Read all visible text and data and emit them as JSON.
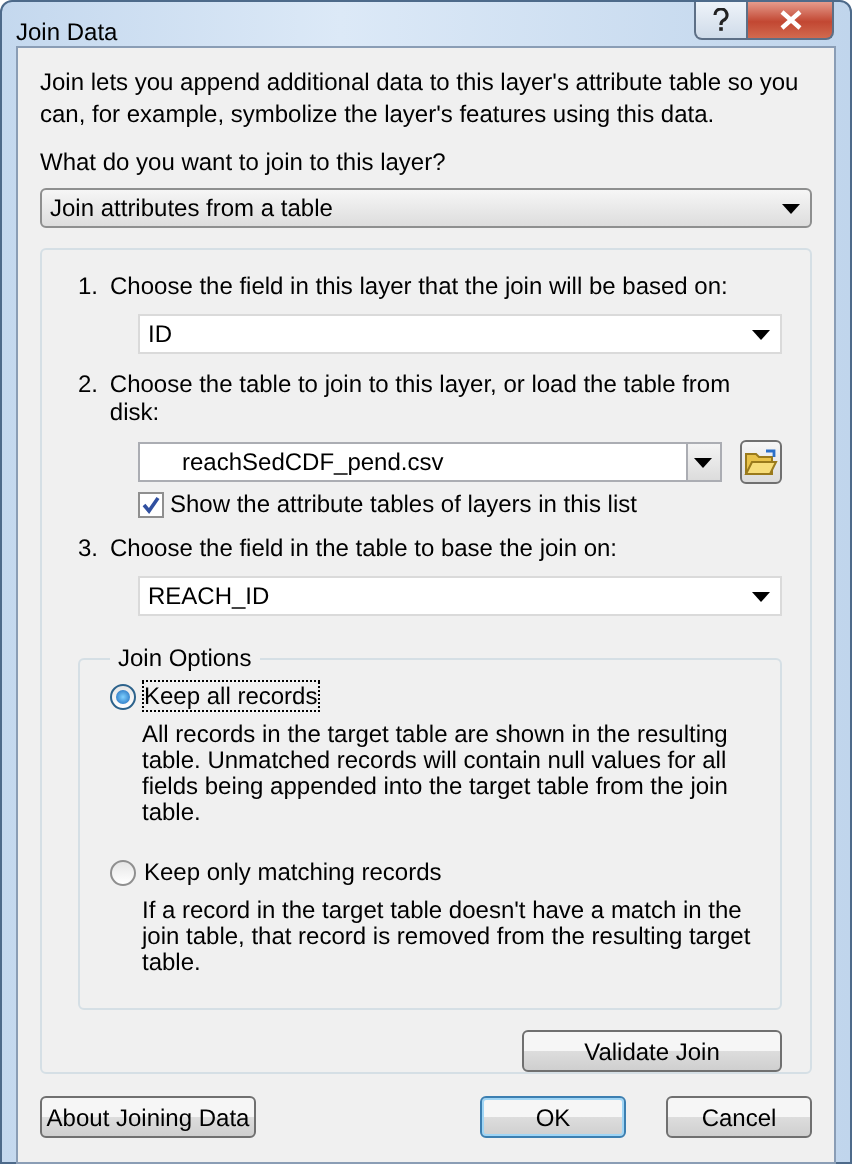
{
  "window": {
    "title": "Join Data"
  },
  "intro": "Join lets you append additional data to this layer's attribute table so you can, for example, symbolize the layer's features using this data.",
  "join_type": {
    "label": "What do you want to join to this layer?",
    "value": "Join attributes from a table"
  },
  "steps": [
    {
      "number": "1.",
      "label": "Choose the field in this layer that the join will be based on:",
      "value": "ID",
      "kind": "dropdown"
    },
    {
      "number": "2.",
      "label": "Choose the table to join to this layer, or load the table from disk:",
      "value": "reachSedCDF_pend.csv",
      "kind": "browse",
      "checkbox": {
        "label": "Show the attribute tables of layers in this list",
        "checked": true
      }
    },
    {
      "number": "3.",
      "label": "Choose the field in the table to base the join on:",
      "value": "REACH_ID",
      "kind": "dropdown"
    }
  ],
  "join_options": {
    "title": "Join Options",
    "options": [
      {
        "label": "Keep all records",
        "selected": true,
        "description": "All records in the target table are shown in the resulting table. Unmatched records will contain null values for all fields being appended into the target table from the join table."
      },
      {
        "label": "Keep only matching records",
        "selected": false,
        "description": "If a record in the target table doesn't have a match in the join table, that record is removed from the resulting target table."
      }
    ]
  },
  "validate_button": "Validate Join",
  "buttons": [
    {
      "label": "About Joining Data",
      "default": false
    },
    {
      "label": "OK",
      "default": true
    },
    {
      "label": "Cancel",
      "default": false
    }
  ]
}
